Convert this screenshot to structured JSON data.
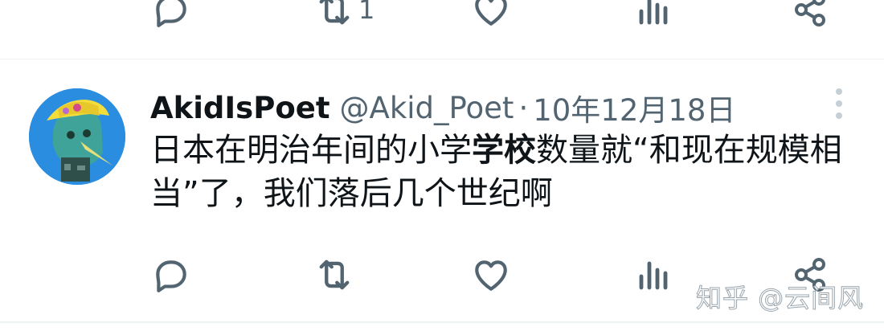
{
  "previous_tweet": {
    "actions": {
      "reply": {
        "icon": "reply-icon"
      },
      "retweet": {
        "icon": "retweet-icon",
        "count": "1"
      },
      "like": {
        "icon": "heart-icon"
      },
      "views": {
        "icon": "views-icon"
      },
      "share": {
        "icon": "share-icon"
      }
    }
  },
  "tweet": {
    "display_name": "AkidIsPoet",
    "handle": "@Akid_Poet",
    "separator": "·",
    "date": "10年12月18日",
    "body_before": "日本在明治年间的小学",
    "body_bold": "学校",
    "body_after": "数量就“和现在规模相当”了，我们落后几个世纪啊",
    "actions": {
      "reply": {
        "icon": "reply-icon"
      },
      "retweet": {
        "icon": "retweet-icon"
      },
      "like": {
        "icon": "heart-icon"
      },
      "views": {
        "icon": "views-icon"
      },
      "share": {
        "icon": "share-icon"
      }
    }
  },
  "watermark": "知乎 @云间风",
  "colors": {
    "text_primary": "#0f1419",
    "text_secondary": "#536471",
    "divider": "#eff3f4",
    "avatar_bg": "#2b8de0"
  }
}
